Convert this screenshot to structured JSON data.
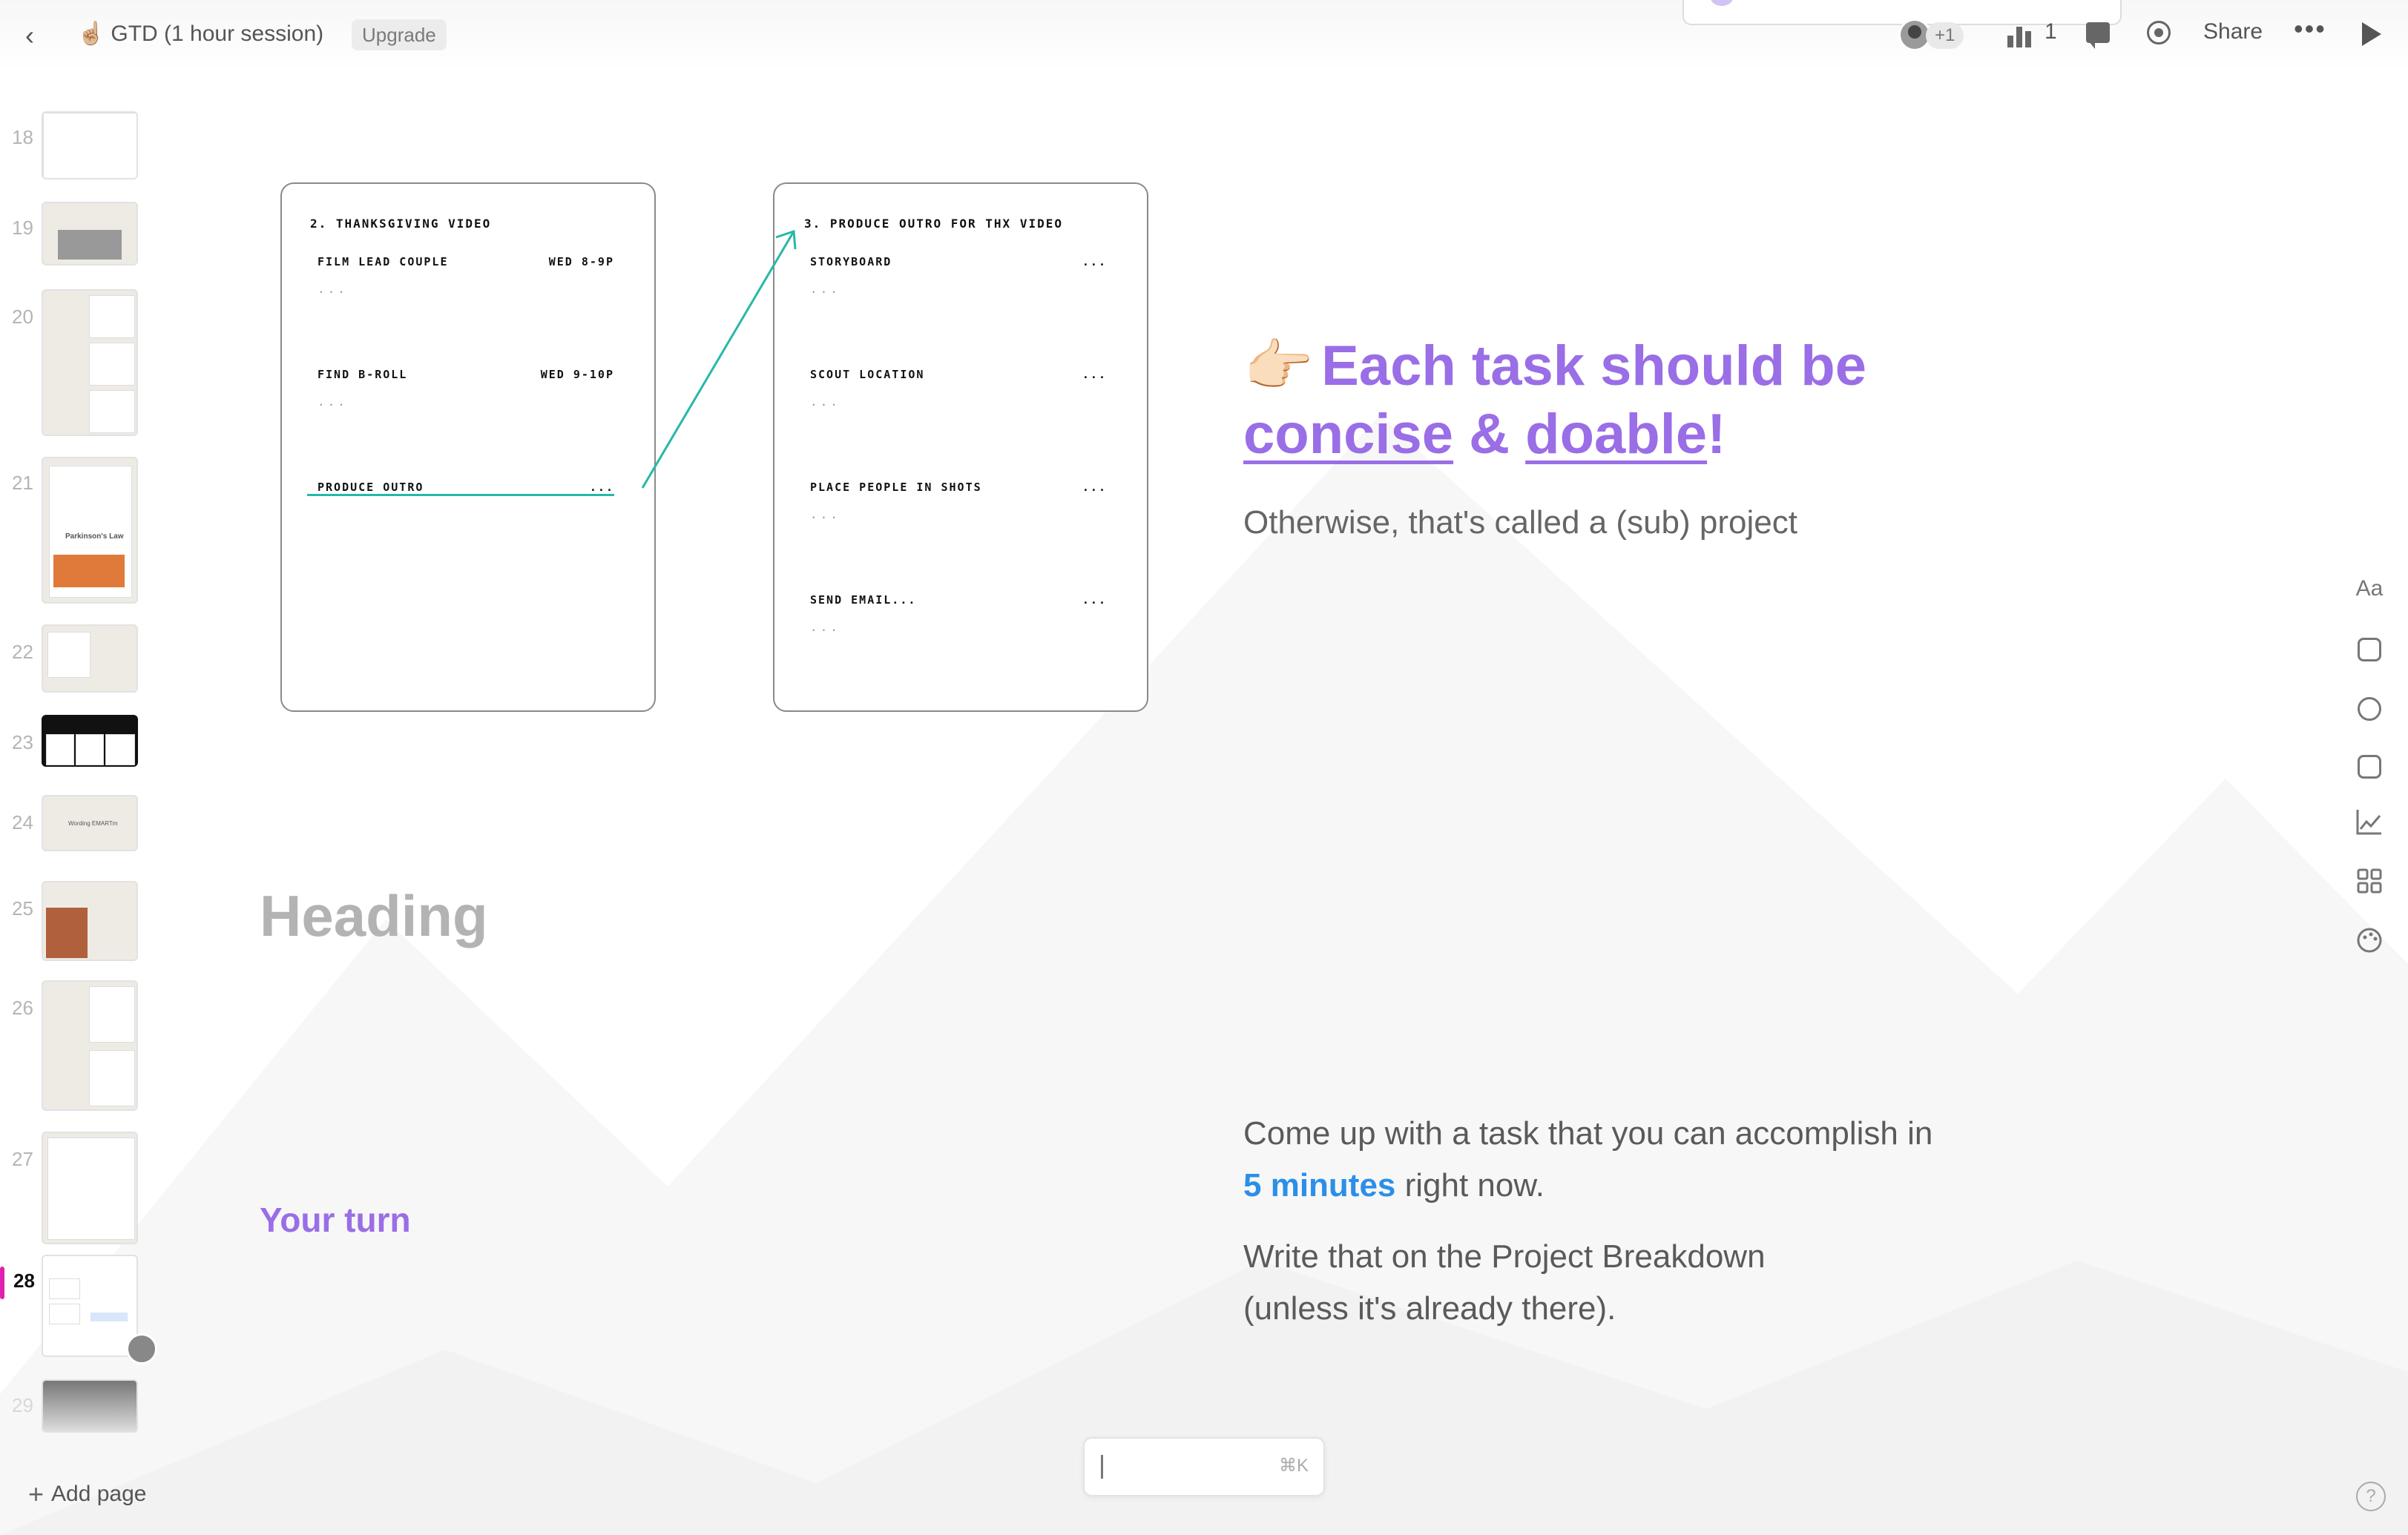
{
  "topbar": {
    "back_icon": "‹",
    "title_emoji": "☝🏼",
    "title": "GTD (1 hour session)",
    "upgrade_label": "Upgrade",
    "collaborators_extra": "+1",
    "stats_count": "1",
    "share_label": "Share",
    "more_icon": "•••"
  },
  "sidebar": {
    "pages": [
      {
        "num": "18"
      },
      {
        "num": "19"
      },
      {
        "num": "20"
      },
      {
        "num": "21",
        "thumb_text": "Parkinson's Law"
      },
      {
        "num": "22"
      },
      {
        "num": "23"
      },
      {
        "num": "24",
        "thumb_text": "Wording EMARTm"
      },
      {
        "num": "25"
      },
      {
        "num": "26"
      },
      {
        "num": "27"
      },
      {
        "num": "28",
        "active": true
      },
      {
        "num": "29"
      }
    ],
    "add_page_label": "Add page"
  },
  "card1": {
    "title": "2. THANKSGIVING VIDEO",
    "tasks": [
      {
        "label": "FILM LEAD COUPLE",
        "when": "WED 8-9P",
        "dots": "..."
      },
      {
        "label": "FIND B-ROLL",
        "when": "WED 9-10P",
        "dots": "..."
      },
      {
        "label": "PRODUCE OUTRO",
        "when": "...",
        "dots": ""
      }
    ]
  },
  "card2": {
    "title": "3. PRODUCE OUTRO FOR THX VIDEO",
    "tasks": [
      {
        "label": "STORYBOARD",
        "when": "...",
        "dots": "..."
      },
      {
        "label": "SCOUT LOCATION",
        "when": "...",
        "dots": "..."
      },
      {
        "label": "PLACE PEOPLE IN SHOTS",
        "when": "...",
        "dots": "..."
      },
      {
        "label": "SEND EMAIL...",
        "when": "...",
        "dots": "..."
      }
    ]
  },
  "main": {
    "headline_emoji": "👉🏻",
    "headline_part1": "Each task should be",
    "headline_word1": "concise",
    "headline_amp": " & ",
    "headline_word2": "doable",
    "headline_end": "!",
    "subtext": "Otherwise, that's called a (sub) project",
    "heading_placeholder": "Heading",
    "your_turn": "Your turn",
    "para1_line1": "Come up with a task that you can accomplish in",
    "para1_highlight": "5 minutes",
    "para1_rest": " right now.",
    "para2_line1": "Write that on the Project Breakdown",
    "para2_line2": "(unless it's already there)."
  },
  "right_toolbar": {
    "text_tool": "Aa"
  },
  "command_bar": {
    "shortcut": "⌘K"
  },
  "help_icon": "?",
  "colors": {
    "accent_purple": "#9a6ee6",
    "accent_blue": "#2b8fe8",
    "arrow_teal": "#27b8a9",
    "active_page": "#e020b0"
  }
}
